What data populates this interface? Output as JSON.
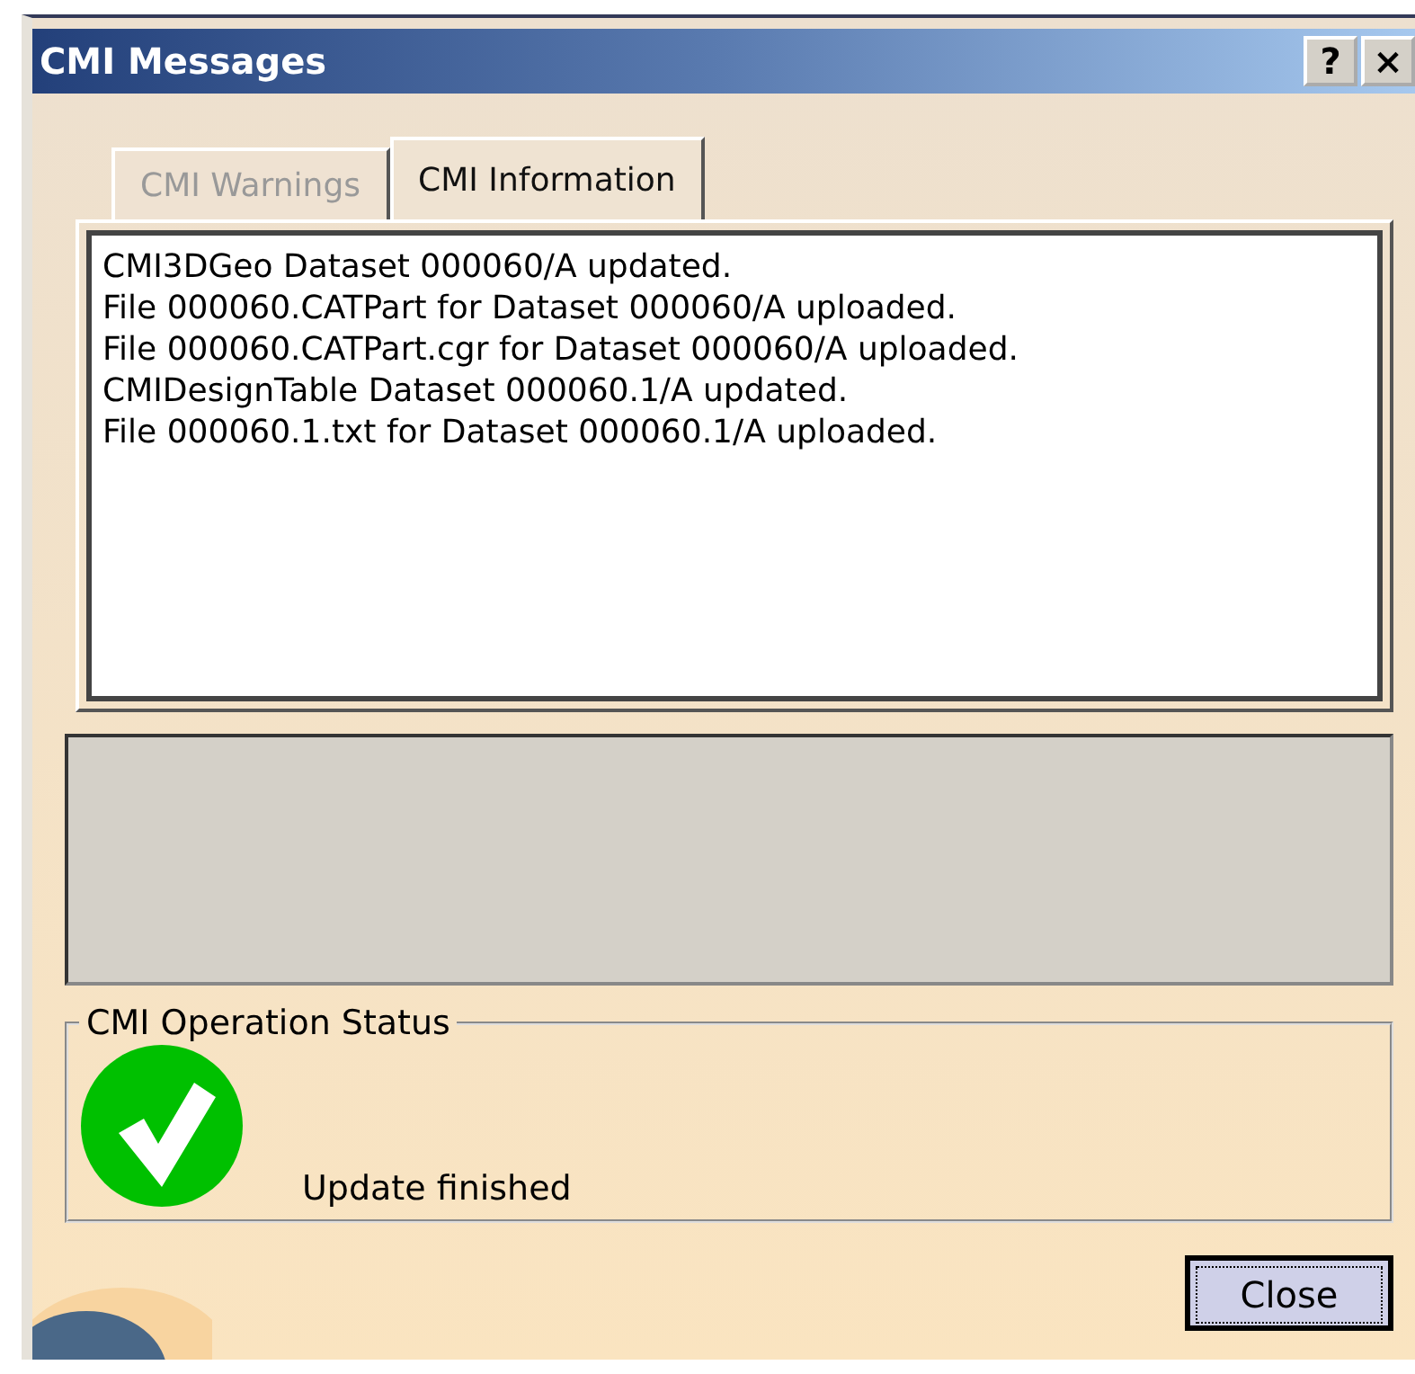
{
  "window": {
    "title": "CMI Messages",
    "help_button": "?",
    "close_button": "×"
  },
  "tabs": [
    {
      "label": "CMI Warnings",
      "selected": false
    },
    {
      "label": "CMI Information",
      "selected": true
    }
  ],
  "messages": [
    "CMI3DGeo Dataset 000060/A updated.",
    "File 000060.CATPart for Dataset 000060/A uploaded.",
    "File 000060.CATPart.cgr for Dataset 000060/A uploaded.",
    "CMIDesignTable Dataset 000060.1/A updated.",
    "File 000060.1.txt for Dataset 000060.1/A uploaded."
  ],
  "operation_status": {
    "title": "CMI Operation Status",
    "kind": "success",
    "message": "Update finished"
  },
  "buttons": [
    "Close"
  ]
}
